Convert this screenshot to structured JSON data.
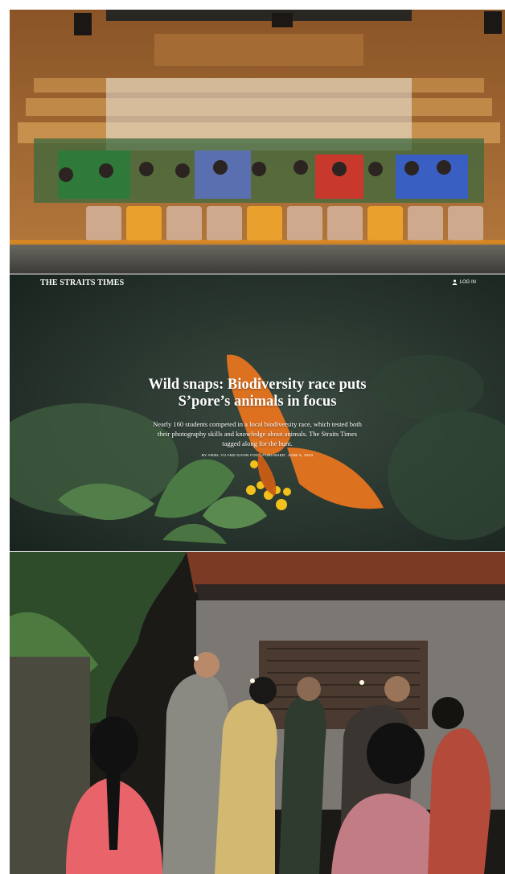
{
  "site": {
    "masthead": "THE STRAITS TIMES",
    "login_label": "LOG IN"
  },
  "article": {
    "title_line1": "Wild snaps: Biodiversity race puts",
    "title_line2": "S’pore’s animals in focus",
    "standfirst_line1": "Nearly 160 students competed in a local biodiversity race, which tested both",
    "standfirst_line2": "their photography skills and knowledge about animals. The Straits Times",
    "standfirst_line3": "tagged along for the hunt.",
    "byline": "BY ARIEL YU AND GAVIN FOO | PUBLISHED: JUNE 5, 2024"
  },
  "icons": {
    "login": "user-icon"
  },
  "colors": {
    "hero_background": "#1d2a24",
    "butterfly_orange": "#e6741f",
    "flower_yellow": "#f2c11b",
    "seat_orange": "#e9a02c",
    "wood_wall": "#b57a3d"
  }
}
